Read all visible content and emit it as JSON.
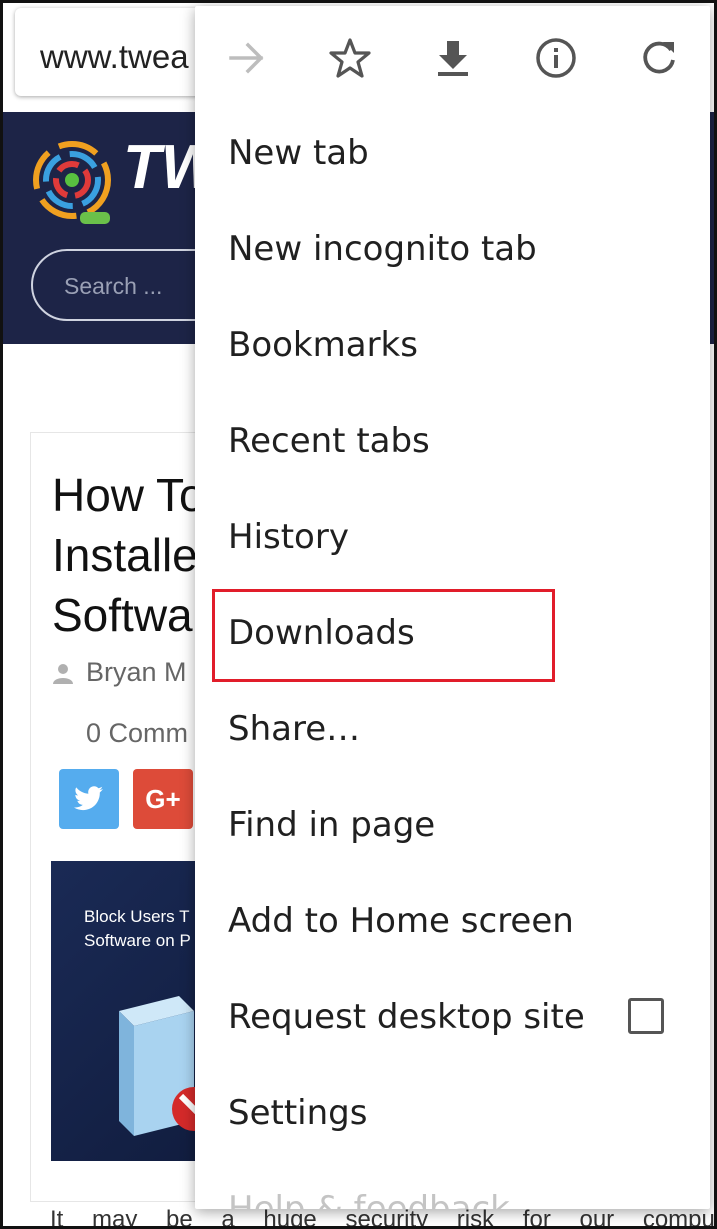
{
  "browser": {
    "url_text": "www.twea"
  },
  "site": {
    "logo_text": "TW",
    "search_placeholder": "Search ..."
  },
  "article": {
    "title": "How To\nInstalle\nSoftwa",
    "author": "Bryan M",
    "comments": "0 Comm",
    "gplus_label": "G+",
    "image_caption": "Block Users T\nSoftware on P",
    "body_start": "It may be a huge security risk for our computer"
  },
  "menu": {
    "toolbar_icons": [
      "forward-icon",
      "bookmark-star-icon",
      "download-icon",
      "info-icon",
      "reload-icon"
    ],
    "items": [
      {
        "label": "New tab"
      },
      {
        "label": "New incognito tab"
      },
      {
        "label": "Bookmarks"
      },
      {
        "label": "Recent tabs"
      },
      {
        "label": "History"
      },
      {
        "label": "Downloads"
      },
      {
        "label": "Share…"
      },
      {
        "label": "Find in page"
      },
      {
        "label": "Add to Home screen"
      },
      {
        "label": "Request desktop site"
      },
      {
        "label": "Settings"
      },
      {
        "label": "Help & feedback"
      }
    ],
    "request_desktop_checked": false,
    "highlighted_item": "Downloads"
  },
  "colors": {
    "header_bg": "#1d2447",
    "highlight_border": "#e11d2a",
    "twitter": "#55acee",
    "gplus": "#dd4b39"
  }
}
